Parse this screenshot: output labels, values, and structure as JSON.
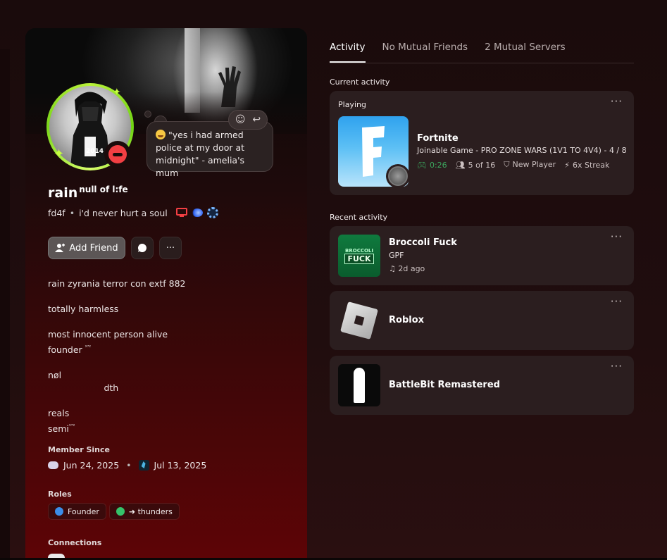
{
  "profile": {
    "display_name": "rain",
    "display_name_suffix": "null of l:fe",
    "username": "fd4f",
    "separator": "•",
    "pronouns": "i'd never hurt a soul",
    "avatar_text": "2014",
    "status_quote": "\"yes i had armed police at my door at midnight\" - amelia's mum",
    "add_friend_label": "Add Friend",
    "bio_lines": [
      "rain zyrania terror con extf 882",
      "",
      "totally harmless",
      "",
      "most innocent person alive",
      "founder",
      "",
      "nøl",
      "                    dth",
      "",
      "reals",
      "semi"
    ],
    "bio_sup": "⁹⁷²",
    "member_since_label": "Member Since",
    "discord_date": "Jun 24, 2025",
    "server_date": "Jul 13, 2025",
    "roles_label": "Roles",
    "roles": [
      {
        "name": "Founder",
        "color": "#3b8ee8"
      },
      {
        "name": "➜ thunders",
        "color": "#35c46a"
      }
    ],
    "connections_label": "Connections"
  },
  "tabs": [
    "Activity",
    "No Mutual Friends",
    "2 Mutual Servers"
  ],
  "current_activity_label": "Current activity",
  "current": {
    "playing_label": "Playing",
    "title": "Fortnite",
    "details": "Joinable Game - PRO ZONE WARS (1V1 TO 4V4) - 4 / 8",
    "elapsed": "0:26",
    "party": "5 of 16",
    "player": "New Player",
    "streak": "6x Streak"
  },
  "recent_activity_label": "Recent activity",
  "recent": [
    {
      "title": "Broccoli Fuck",
      "sub": "GPF",
      "meta": "2d ago",
      "thumb_top": "BROCCOLI",
      "thumb_main": "FUCK"
    },
    {
      "title": "Roblox"
    },
    {
      "title": "BattleBit Remastered"
    }
  ],
  "more_glyph": "···"
}
